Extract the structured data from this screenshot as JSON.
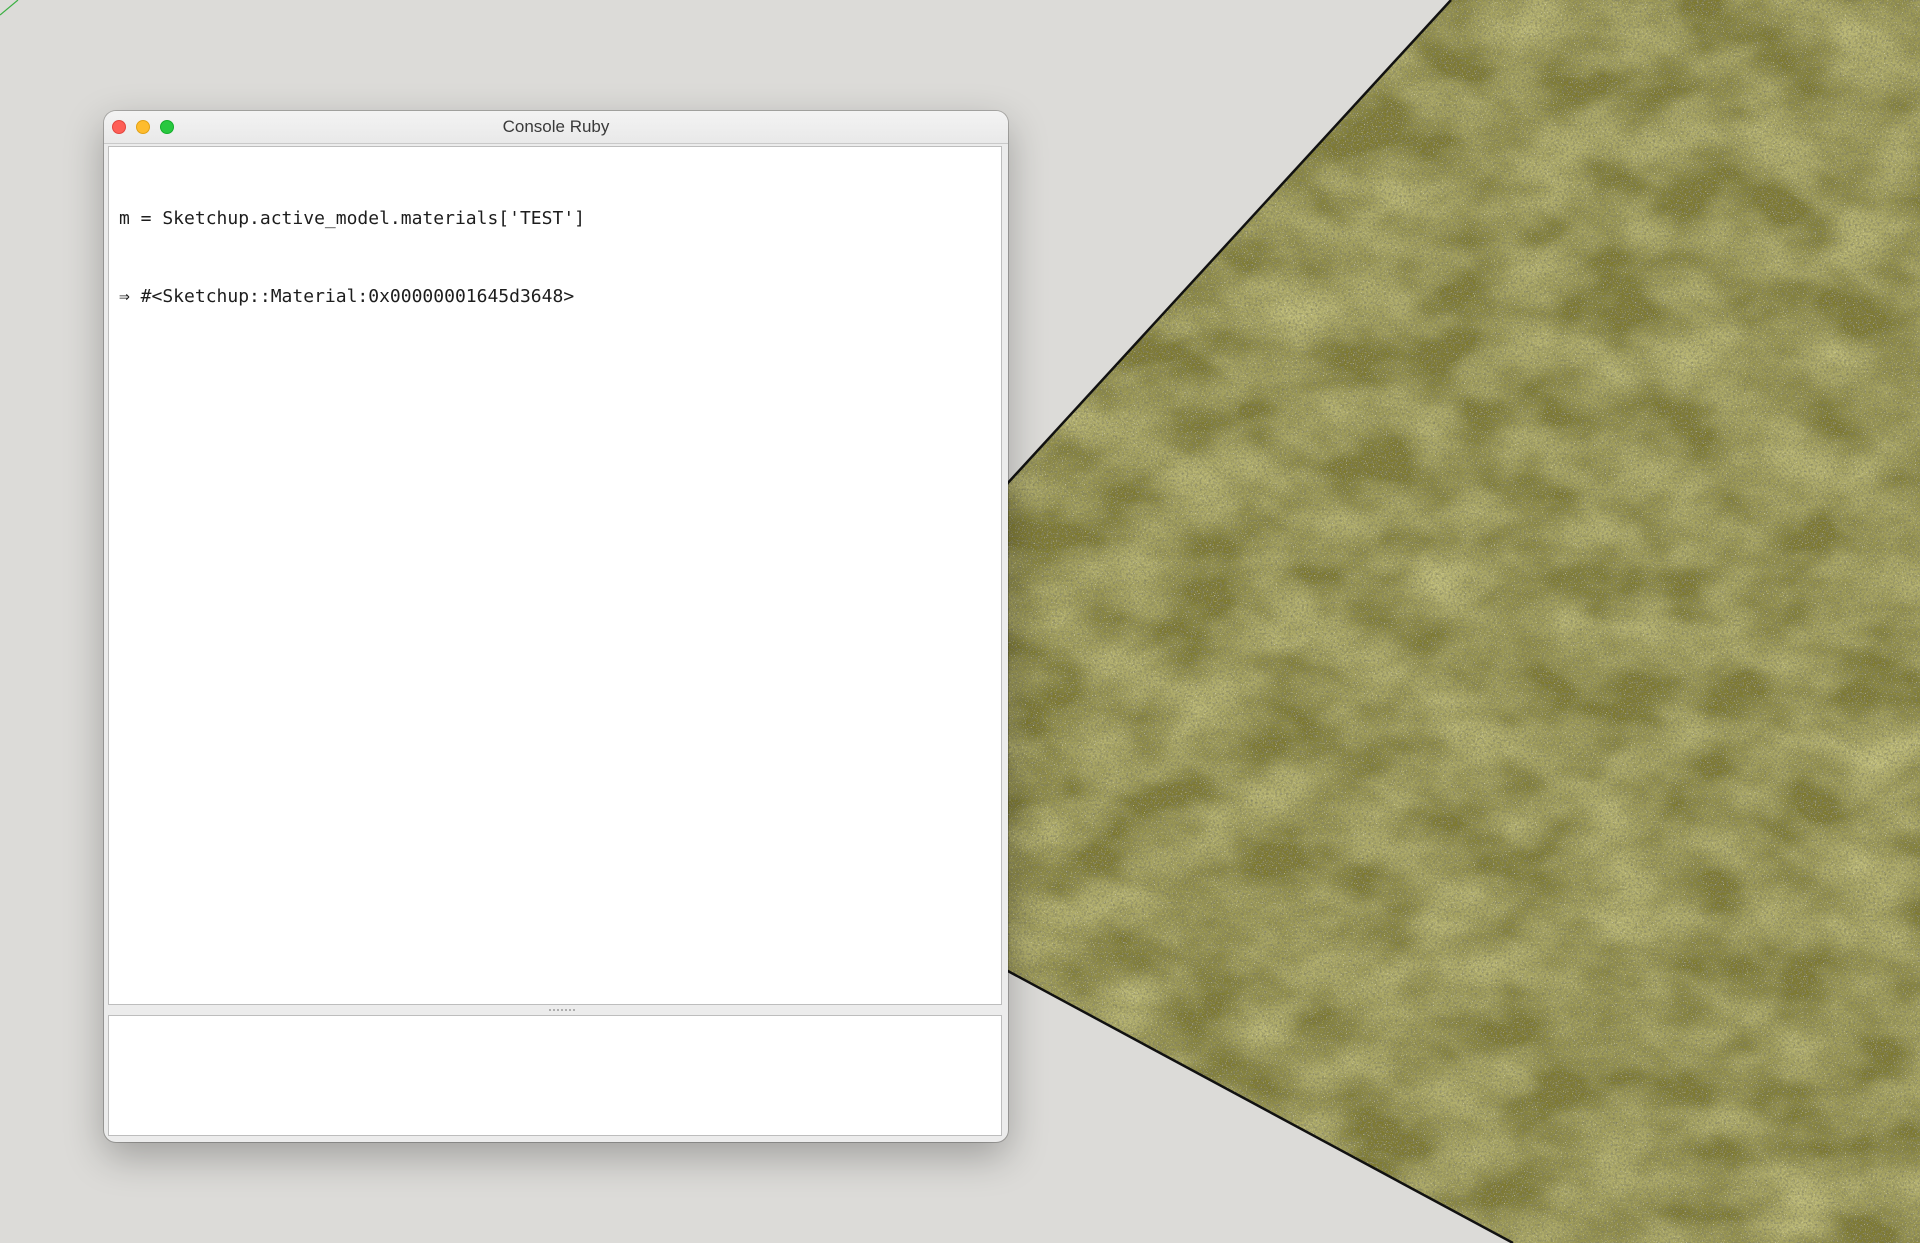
{
  "window": {
    "title": "Console Ruby",
    "controls": {
      "close": "close-button",
      "minimize": "minimize-button",
      "zoom": "zoom-button"
    }
  },
  "console": {
    "output_lines": [
      "m = Sketchup.active_model.materials['TEST']",
      "⇒ #<Sketchup::Material:0x00000001645d3648>"
    ],
    "input_value": ""
  },
  "scene": {
    "background_color": "#dcdbd8",
    "material_color": "#8f8a2c",
    "edge_color": "#111111",
    "axis_color": "#3cb043"
  }
}
